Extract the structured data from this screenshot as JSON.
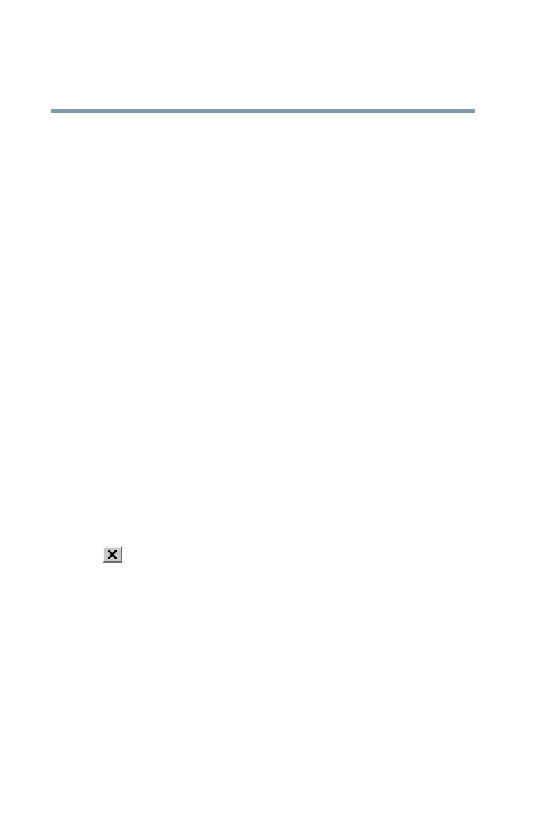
{
  "header_rule": {
    "color": "#7f9aab"
  },
  "close_button": {
    "icon": "close-icon",
    "face_color": "#c8c8c8",
    "glyph_color": "#000000"
  }
}
